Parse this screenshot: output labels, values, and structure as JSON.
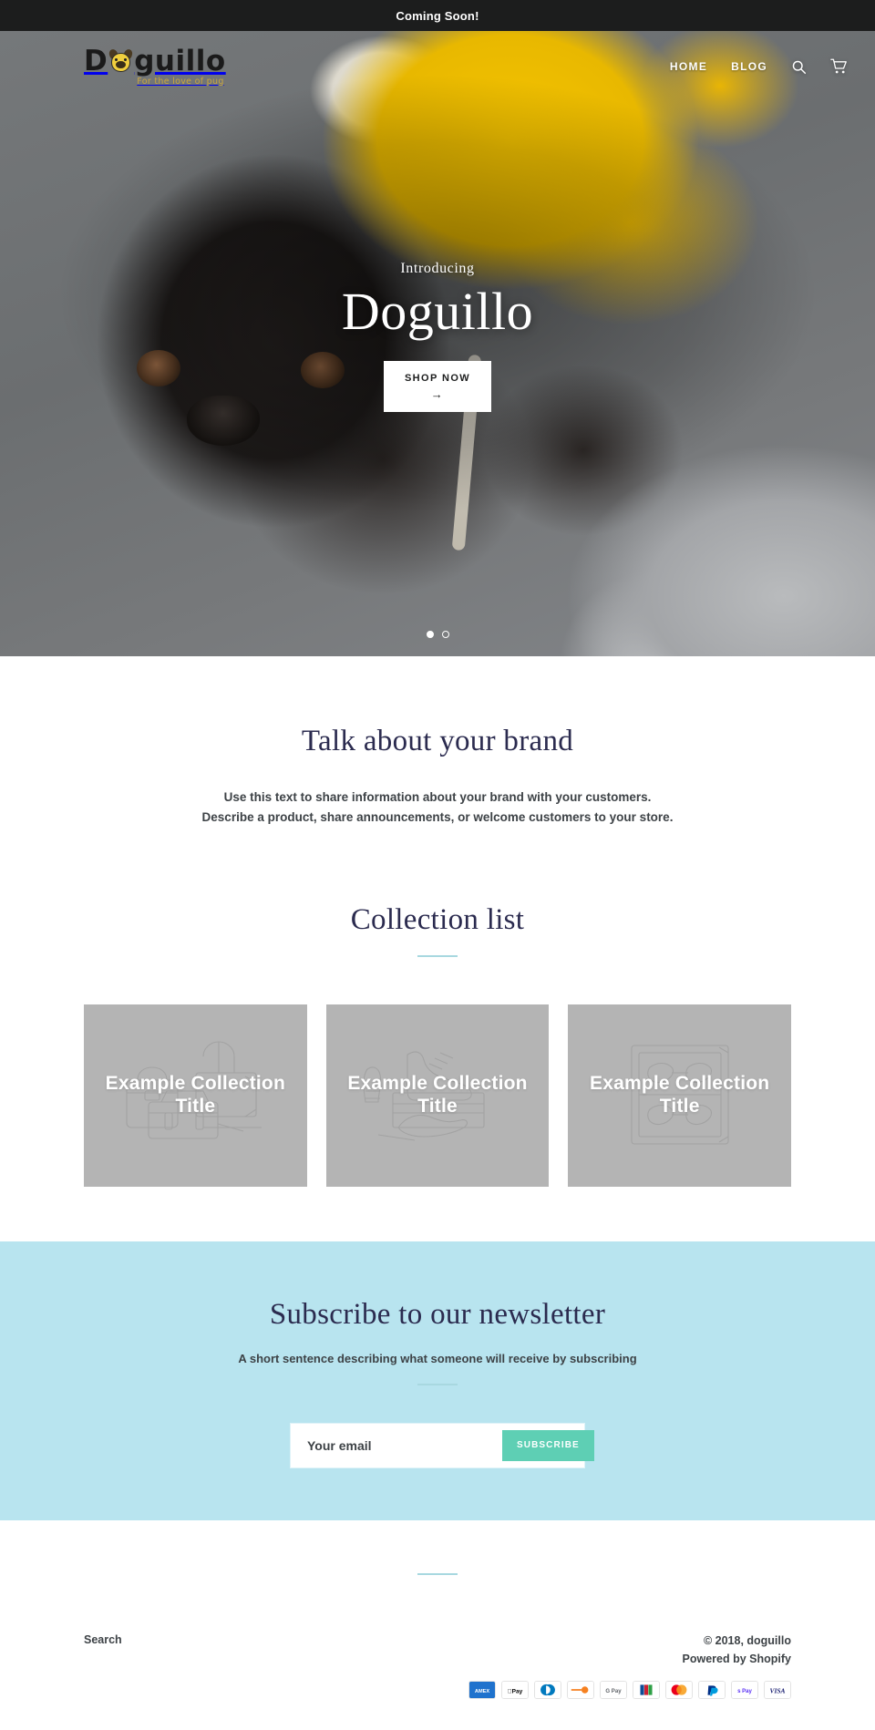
{
  "announcement": {
    "text": "Coming Soon!"
  },
  "header": {
    "logo": {
      "text_before": "D",
      "icon": "pug-face-icon",
      "text_after": "guillo",
      "tagline": "For the love of pug"
    },
    "nav": [
      {
        "label": "HOME",
        "name": "nav-link-home"
      },
      {
        "label": "BLOG",
        "name": "nav-link-blog"
      }
    ],
    "icons": [
      {
        "name": "search-icon",
        "label": "Search"
      },
      {
        "name": "cart-icon",
        "label": "Cart"
      }
    ]
  },
  "hero": {
    "kicker": "Introducing",
    "title": "Doguillo",
    "button_label": "SHOP NOW",
    "button_arrow": "→",
    "slides": 2,
    "active_slide": 1
  },
  "richtext": {
    "title": "Talk about your brand",
    "line1": "Use this text to share information about your brand with your customers.",
    "line2": "Describe a product, share announcements, or welcome customers to your store."
  },
  "collections": {
    "title": "Collection list",
    "items": [
      {
        "title": "Example Collection Title",
        "placeholder": "bags-illustration"
      },
      {
        "title": "Example Collection Title",
        "placeholder": "shoes-illustration"
      },
      {
        "title": "Example Collection Title",
        "placeholder": "sunglasses-illustration"
      }
    ]
  },
  "newsletter": {
    "title": "Subscribe to our newsletter",
    "subtitle": "A short sentence describing what someone will receive by subscribing",
    "email_placeholder": "Your email",
    "email_value": "",
    "button_label": "SUBSCRIBE"
  },
  "footer": {
    "search_link": "Search",
    "copyright": "© 2018, doguillo",
    "powered_by": "Powered by Shopify",
    "payment_methods": [
      "american-express",
      "apple-pay",
      "diners-club",
      "discover",
      "google-pay",
      "jcb",
      "mastercard",
      "paypal",
      "shop-pay",
      "visa"
    ]
  },
  "colors": {
    "announcement_bg": "#1c1d1d",
    "heading": "#2b2b4f",
    "newsletter_bg": "#b8e4ef",
    "accent_button": "#5ecfb4",
    "divider": "#a8d8e0",
    "placeholder_card": "#b4b4b4"
  }
}
